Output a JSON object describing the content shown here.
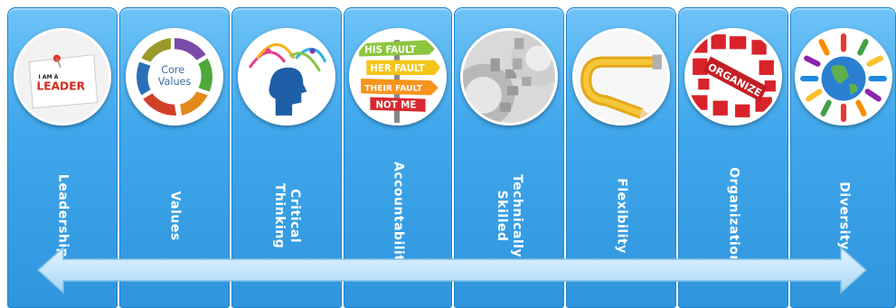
{
  "panels": [
    {
      "label": "Leadership",
      "icon": "leader-note-icon"
    },
    {
      "label": "Values",
      "icon": "core-values-cycle-icon"
    },
    {
      "label": "Critical\nThinking",
      "icon": "thinking-head-icon"
    },
    {
      "label": "Accountability",
      "icon": "fault-signpost-icon"
    },
    {
      "label": "Technically\nSkilled",
      "icon": "gears-icon"
    },
    {
      "label": "Flexibility",
      "icon": "bent-pencil-icon"
    },
    {
      "label": "Organization",
      "icon": "puzzle-organize-icon"
    },
    {
      "label": "Diversity",
      "icon": "globe-people-icon"
    }
  ],
  "icons_text": {
    "leader_small": "I AM A",
    "leader_big": "LEADER",
    "core_values": "Core\nValues",
    "fault_1": "HIS FAULT",
    "fault_2": "HER FAULT",
    "fault_3": "THEIR FAULT",
    "fault_4": "NOT ME",
    "organize": "ORGANIZE"
  },
  "colors": {
    "panel_blue": "#41a8ec",
    "arrow_blue": "#bfe3fb",
    "label_text": "#ffffff"
  }
}
